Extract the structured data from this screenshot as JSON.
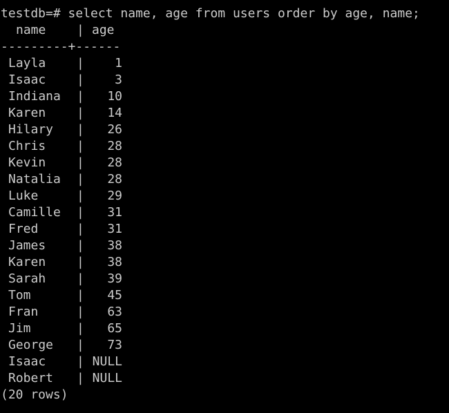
{
  "terminal": {
    "prompt": "testdb=#",
    "command": "select name, age from users order by age, name;",
    "header": {
      "name": "name",
      "age": "age",
      "separator": "|"
    },
    "rule": "---------+------",
    "rows": [
      {
        "name": "Layla",
        "age": "1"
      },
      {
        "name": "Isaac",
        "age": "3"
      },
      {
        "name": "Indiana",
        "age": "10"
      },
      {
        "name": "Karen",
        "age": "14"
      },
      {
        "name": "Hilary",
        "age": "26"
      },
      {
        "name": "Chris",
        "age": "28"
      },
      {
        "name": "Kevin",
        "age": "28"
      },
      {
        "name": "Natalia",
        "age": "28"
      },
      {
        "name": "Luke",
        "age": "29"
      },
      {
        "name": "Camille",
        "age": "31"
      },
      {
        "name": "Fred",
        "age": "31"
      },
      {
        "name": "James",
        "age": "38"
      },
      {
        "name": "Karen",
        "age": "38"
      },
      {
        "name": "Sarah",
        "age": "39"
      },
      {
        "name": "Tom",
        "age": "45"
      },
      {
        "name": "Fran",
        "age": "63"
      },
      {
        "name": "Jim",
        "age": "65"
      },
      {
        "name": "George",
        "age": "73"
      },
      {
        "name": "Isaac",
        "age": "NULL"
      },
      {
        "name": "Robert",
        "age": "NULL"
      }
    ],
    "footer": "(20 rows)"
  },
  "colors": {
    "background": "#000000",
    "text": "#cccccc"
  }
}
